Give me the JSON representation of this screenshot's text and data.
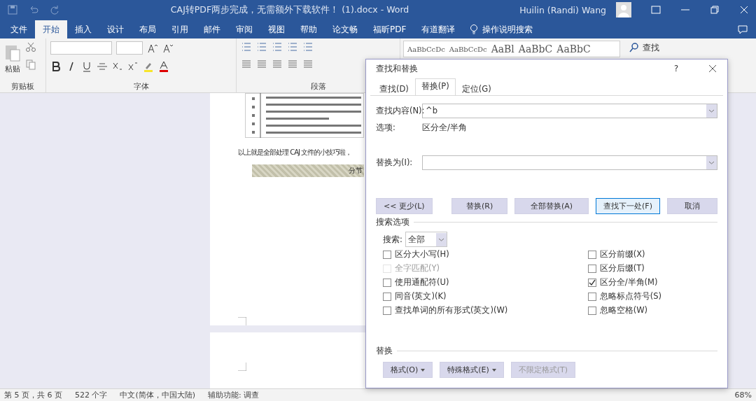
{
  "window": {
    "title": "CAJ转PDF两步完成，无需额外下载软件！ (1).docx  -  Word",
    "user": "Huilin (Randi) Wang"
  },
  "ribbon_tabs": [
    {
      "label": "文件",
      "selected": false
    },
    {
      "label": "开始",
      "selected": true
    },
    {
      "label": "插入",
      "selected": false
    },
    {
      "label": "设计",
      "selected": false
    },
    {
      "label": "布局",
      "selected": false
    },
    {
      "label": "引用",
      "selected": false
    },
    {
      "label": "邮件",
      "selected": false
    },
    {
      "label": "审阅",
      "selected": false
    },
    {
      "label": "视图",
      "selected": false
    },
    {
      "label": "帮助",
      "selected": false
    },
    {
      "label": "论文畅",
      "selected": false
    },
    {
      "label": "福昕PDF",
      "selected": false
    },
    {
      "label": "有道翻译",
      "selected": false
    }
  ],
  "tell_me": "操作说明搜索",
  "ribbon": {
    "paste_label": "粘贴",
    "groups": [
      "剪贴板",
      "字体",
      "段落"
    ],
    "style_samples": [
      "AaBbCcDc",
      "AaBbCcDc",
      "AaBl",
      "AaBbC",
      "AaBbC"
    ],
    "find_label": "查找"
  },
  "document": {
    "sentence": "以上就是全部处理 CAJ 文件的小技巧啦，",
    "section_break": "分节"
  },
  "dialog": {
    "title": "查找和替换",
    "help": "?",
    "tabs": [
      {
        "label": "查找(D)",
        "selected": false
      },
      {
        "label": "替换(P)",
        "selected": true
      },
      {
        "label": "定位(G)",
        "selected": false
      }
    ],
    "find_label": "查找内容(N):",
    "find_value": "^b",
    "options_label": "选项:",
    "options_value": "区分全/半角",
    "replace_label": "替换为(I):",
    "buttons": [
      {
        "label": "<< 更少(L)",
        "highlighted": false
      },
      {
        "label": "替换(R)",
        "highlighted": false
      },
      {
        "label": "全部替换(A)",
        "highlighted": false
      },
      {
        "label": "查找下一处(F)",
        "highlighted": true
      },
      {
        "label": "取消",
        "highlighted": false
      }
    ],
    "search_section": "搜索选项",
    "search_label": "搜索:",
    "search_value": "全部",
    "left_options": [
      {
        "label": "区分大小写(H)",
        "checked": false,
        "disabled": false
      },
      {
        "label": "全字匹配(Y)",
        "checked": false,
        "disabled": true
      },
      {
        "label": "使用通配符(U)",
        "checked": false,
        "disabled": false
      },
      {
        "label": "同音(英文)(K)",
        "checked": false,
        "disabled": false
      },
      {
        "label": "查找单词的所有形式(英文)(W)",
        "checked": false,
        "disabled": false
      }
    ],
    "right_options": [
      {
        "label": "区分前缀(X)",
        "checked": false,
        "disabled": false
      },
      {
        "label": "区分后缀(T)",
        "checked": false,
        "disabled": false
      },
      {
        "label": "区分全/半角(M)",
        "checked": true,
        "disabled": false
      },
      {
        "label": "忽略标点符号(S)",
        "checked": false,
        "disabled": false
      },
      {
        "label": "忽略空格(W)",
        "checked": false,
        "disabled": false
      }
    ],
    "replace_section": "替换",
    "format_buttons": [
      {
        "label": "格式(O)",
        "dropdown": true,
        "disabled": false
      },
      {
        "label": "特殊格式(E)",
        "dropdown": true,
        "disabled": false
      },
      {
        "label": "不限定格式(T)",
        "dropdown": false,
        "disabled": true
      }
    ]
  },
  "status_bar": {
    "page": "第 5 页，共 6 页",
    "words": "522 个字",
    "language": "中文(简体，中国大陆)",
    "accessibility": "辅助功能: 调查",
    "zoom": "68%"
  }
}
